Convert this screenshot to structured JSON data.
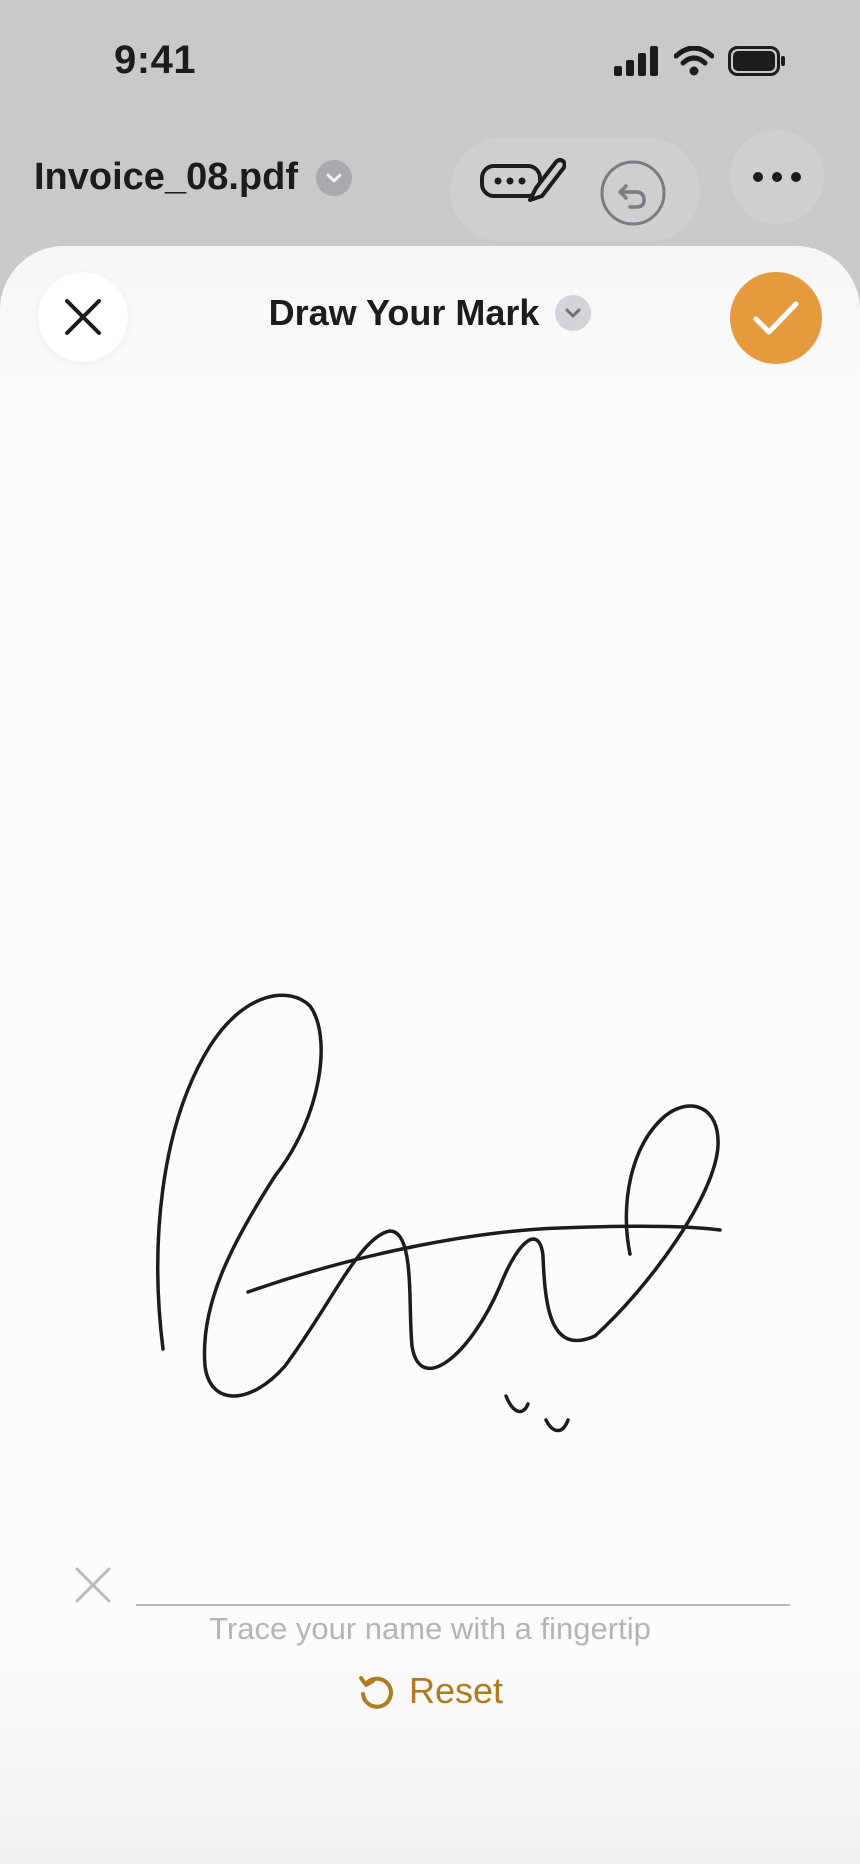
{
  "status_bar": {
    "time": "9:41",
    "icons": [
      "cellular-signal-icon",
      "wifi-icon",
      "battery-icon"
    ]
  },
  "document": {
    "filename": "Invoice_08.pdf",
    "tools": [
      "signature-tool-icon",
      "undo-icon",
      "more-icon"
    ]
  },
  "sheet": {
    "title": "Draw Your Mark",
    "close_icon": "close-icon",
    "confirm_icon": "checkmark-icon"
  },
  "signature_pad": {
    "hint": "Trace your name with a fingertip",
    "reset_label": "Reset",
    "clear_icon": "clear-x-icon"
  },
  "colors": {
    "accent": "#e59a3e",
    "reset_text": "#b07a1e",
    "ink": "#1c1c1e",
    "hint": "#b4b4b9"
  }
}
